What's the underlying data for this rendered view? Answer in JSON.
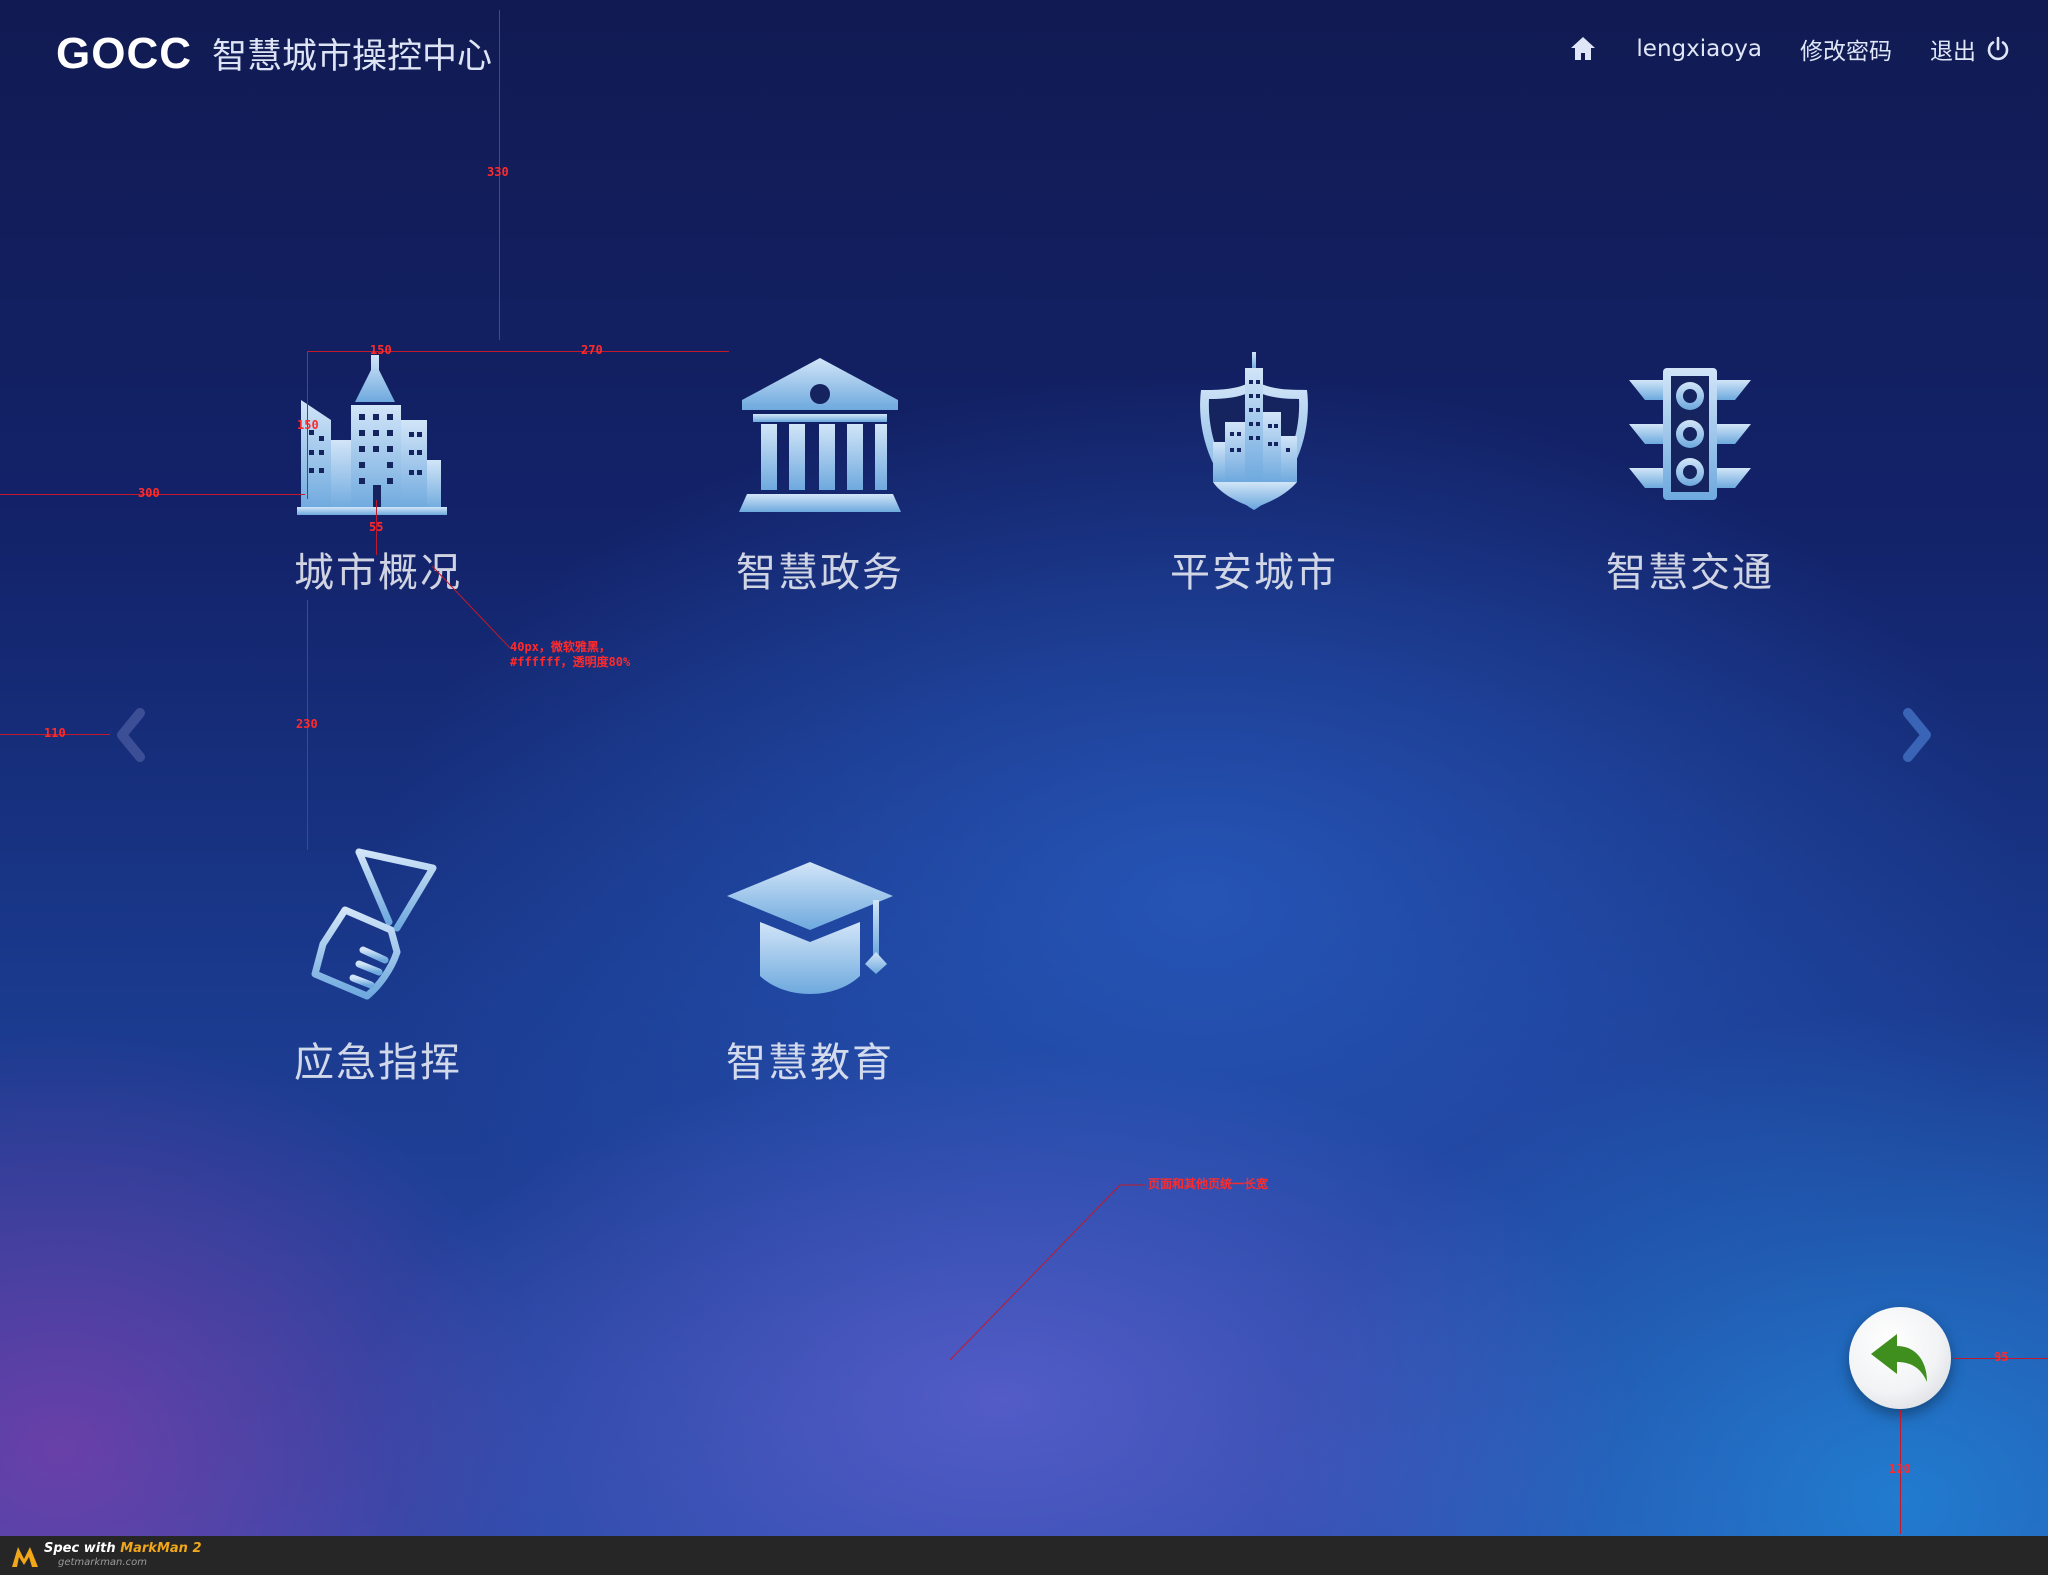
{
  "header": {
    "logo_mark": "GOCC",
    "title": "智慧城市操控中心",
    "nav": {
      "username": "lengxiaoya",
      "change_password": "修改密码",
      "logout": "退出"
    }
  },
  "tiles": [
    {
      "label": "城市概况",
      "icon": "city-buildings-icon"
    },
    {
      "label": "智慧政务",
      "icon": "government-building-icon"
    },
    {
      "label": "平安城市",
      "icon": "city-shield-icon"
    },
    {
      "label": "智慧交通",
      "icon": "traffic-light-icon"
    },
    {
      "label": "应急指挥",
      "icon": "command-flag-hand-icon"
    },
    {
      "label": "智慧教育",
      "icon": "graduation-cap-icon"
    }
  ],
  "annotations": {
    "top_gap": "330",
    "icon_width": "150",
    "icon_gap": "270",
    "icon_height": "150",
    "left_margin": "300",
    "label_gap": "55",
    "font_note_1": "40px，微软雅黑，",
    "font_note_2": "#ffffff，透明度80%",
    "row_gap": "230",
    "arrow_margin": "110",
    "bg_note": "页面和其他页统一长宽",
    "back_right": "95",
    "back_bottom": "120"
  },
  "footer": {
    "spec_prefix": "Spec with",
    "brand": "MarkMan 2",
    "url": "getmarkman.com"
  },
  "colors": {
    "background_top": "#111a52",
    "background_bottom": "#2a4aa8",
    "icon_light": "#cfe3f7",
    "icon_dark": "#6aa8df",
    "label": "#ffffff",
    "annotation": "#ff2b2b",
    "back_arrow": "#3f8f1f"
  }
}
